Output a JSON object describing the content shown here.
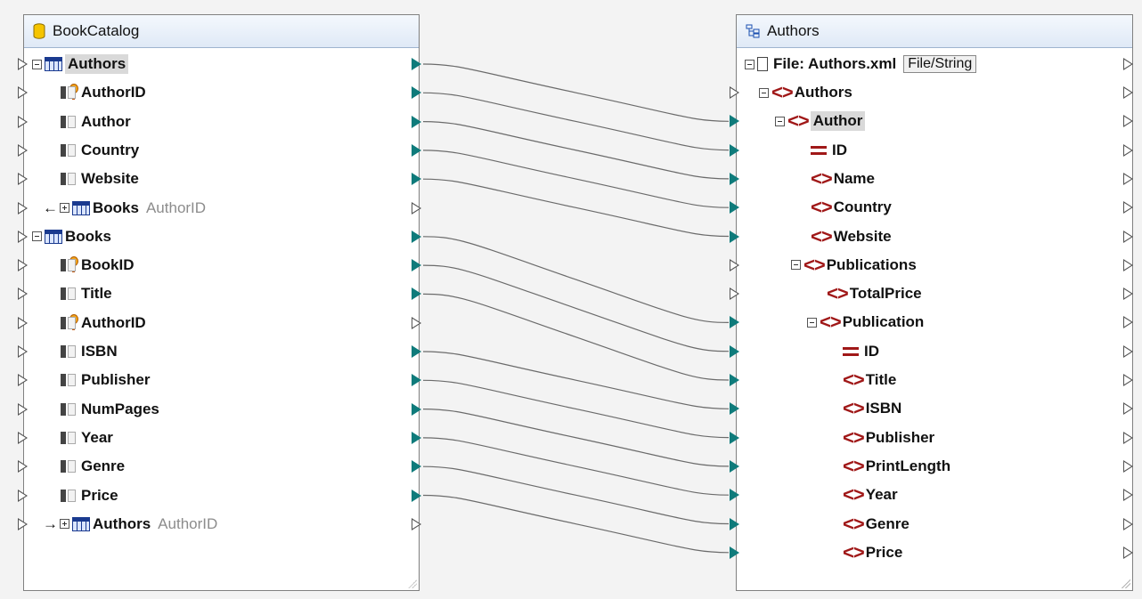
{
  "source": {
    "title": "BookCatalog",
    "icon": "database-icon",
    "rows": [
      {
        "label": "Authors",
        "kind": "table",
        "expand": "minus",
        "indent": 0,
        "highlight": true,
        "out": "filled"
      },
      {
        "label": "AuthorID",
        "kind": "key",
        "indent": 1,
        "out": "filled"
      },
      {
        "label": "Author",
        "kind": "column",
        "indent": 1,
        "out": "filled"
      },
      {
        "label": "Country",
        "kind": "column",
        "indent": 1,
        "out": "filled"
      },
      {
        "label": "Website",
        "kind": "column",
        "indent": 1,
        "out": "filled"
      },
      {
        "label": "Books",
        "sub": "AuthorID",
        "kind": "table",
        "expand": "plus",
        "arrow": "←",
        "indent": 1,
        "out": "empty"
      },
      {
        "label": "Books",
        "kind": "table",
        "expand": "minus",
        "indent": 0,
        "out": "filled"
      },
      {
        "label": "BookID",
        "kind": "key",
        "indent": 1,
        "out": "filled"
      },
      {
        "label": "Title",
        "kind": "column",
        "indent": 1,
        "out": "filled"
      },
      {
        "label": "AuthorID",
        "kind": "key",
        "indent": 1,
        "out": "empty"
      },
      {
        "label": "ISBN",
        "kind": "column",
        "indent": 1,
        "out": "filled"
      },
      {
        "label": "Publisher",
        "kind": "column",
        "indent": 1,
        "out": "filled"
      },
      {
        "label": "NumPages",
        "kind": "column",
        "indent": 1,
        "out": "filled"
      },
      {
        "label": "Year",
        "kind": "column",
        "indent": 1,
        "out": "filled"
      },
      {
        "label": "Genre",
        "kind": "column",
        "indent": 1,
        "out": "filled"
      },
      {
        "label": "Price",
        "kind": "column",
        "indent": 1,
        "out": "filled"
      },
      {
        "label": "Authors",
        "sub": "AuthorID",
        "kind": "table",
        "expand": "plus",
        "arrow": "→",
        "indent": 1,
        "out": "empty"
      }
    ]
  },
  "target": {
    "title": "Authors",
    "icon": "xml-schema-icon",
    "file_label": "File: Authors.xml",
    "file_button": "File/String",
    "rows": [
      {
        "label": "Authors",
        "kind": "element",
        "expand": "minus",
        "indent": 1,
        "in": "empty"
      },
      {
        "label": "Author",
        "kind": "element",
        "expand": "minus",
        "indent": 2,
        "highlight": true,
        "in": "filled"
      },
      {
        "label": "ID",
        "kind": "attribute",
        "indent": 3,
        "in": "filled"
      },
      {
        "label": "Name",
        "kind": "element",
        "indent": 3,
        "in": "filled"
      },
      {
        "label": "Country",
        "kind": "element",
        "indent": 3,
        "in": "filled"
      },
      {
        "label": "Website",
        "kind": "element",
        "indent": 3,
        "in": "filled"
      },
      {
        "label": "Publications",
        "kind": "element",
        "expand": "minus",
        "indent": 3,
        "in": "empty"
      },
      {
        "label": "TotalPrice",
        "kind": "element",
        "indent": 4,
        "in": "empty"
      },
      {
        "label": "Publication",
        "kind": "element",
        "expand": "minus",
        "indent": 4,
        "in": "filled"
      },
      {
        "label": "ID",
        "kind": "attribute",
        "indent": 5,
        "in": "filled"
      },
      {
        "label": "Title",
        "kind": "element",
        "indent": 5,
        "in": "filled"
      },
      {
        "label": "ISBN",
        "kind": "element",
        "indent": 5,
        "in": "filled"
      },
      {
        "label": "Publisher",
        "kind": "element",
        "indent": 5,
        "in": "filled"
      },
      {
        "label": "PrintLength",
        "kind": "element",
        "indent": 5,
        "in": "filled"
      },
      {
        "label": "Year",
        "kind": "element",
        "indent": 5,
        "in": "filled"
      },
      {
        "label": "Genre",
        "kind": "element",
        "indent": 5,
        "in": "filled"
      },
      {
        "label": "Price",
        "kind": "element",
        "indent": 5,
        "in": "filled"
      }
    ]
  },
  "connections": [
    {
      "from": 0,
      "to": 1
    },
    {
      "from": 1,
      "to": 2
    },
    {
      "from": 2,
      "to": 3
    },
    {
      "from": 3,
      "to": 4
    },
    {
      "from": 4,
      "to": 5
    },
    {
      "from": 6,
      "to": 8
    },
    {
      "from": 7,
      "to": 9
    },
    {
      "from": 8,
      "to": 10
    },
    {
      "from": 10,
      "to": 11
    },
    {
      "from": 11,
      "to": 12
    },
    {
      "from": 12,
      "to": 13
    },
    {
      "from": 13,
      "to": 14
    },
    {
      "from": 14,
      "to": 15
    },
    {
      "from": 15,
      "to": 16
    }
  ]
}
